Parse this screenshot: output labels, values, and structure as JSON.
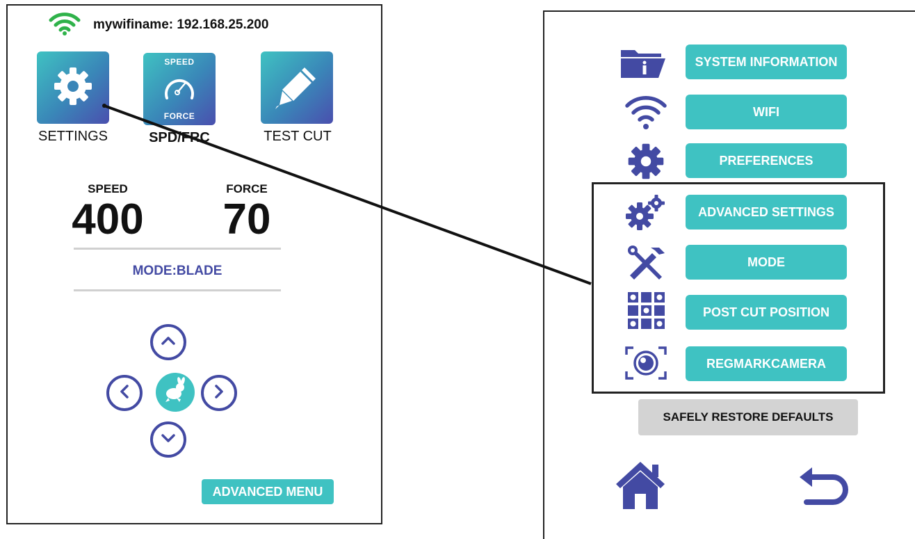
{
  "left": {
    "wifi_label": "mywifiname: 192.168.25.200",
    "tiles": {
      "settings_label": "SETTINGS",
      "spd_frc_label": "SPD/FRC",
      "spd_tile_top": "SPEED",
      "spd_tile_bottom": "FORCE",
      "test_cut_label": "TEST CUT"
    },
    "speed": {
      "label": "SPEED",
      "value": "400"
    },
    "force": {
      "label": "FORCE",
      "value": "70"
    },
    "mode_text": "MODE:BLADE",
    "advanced_menu_label": "ADVANCED MENU"
  },
  "right": {
    "menu": {
      "system_information": "SYSTEM INFORMATION",
      "wifi": "WIFI",
      "preferences": "PREFERENCES",
      "advanced_settings": "ADVANCED SETTINGS",
      "mode": "MODE",
      "post_cut_position": "POST CUT POSITION",
      "regmark_camera": "REGMARKCAMERA"
    },
    "restore_label": "SAFELY RESTORE DEFAULTS"
  },
  "icons": [
    "wifi-icon",
    "gear-icon",
    "speedometer-icon",
    "pen-icon",
    "arrow-up-icon",
    "arrow-left-icon",
    "arrow-right-icon",
    "arrow-down-icon",
    "rabbit-icon",
    "folder-info-icon",
    "gears-icon",
    "tools-icon",
    "grid-icon",
    "camera-icon",
    "home-icon",
    "back-icon"
  ],
  "colors": {
    "teal": "#3fc2c2",
    "indigo": "#434aa3",
    "wifi_green": "#2fb24a",
    "grey": "#d3d3d3"
  }
}
